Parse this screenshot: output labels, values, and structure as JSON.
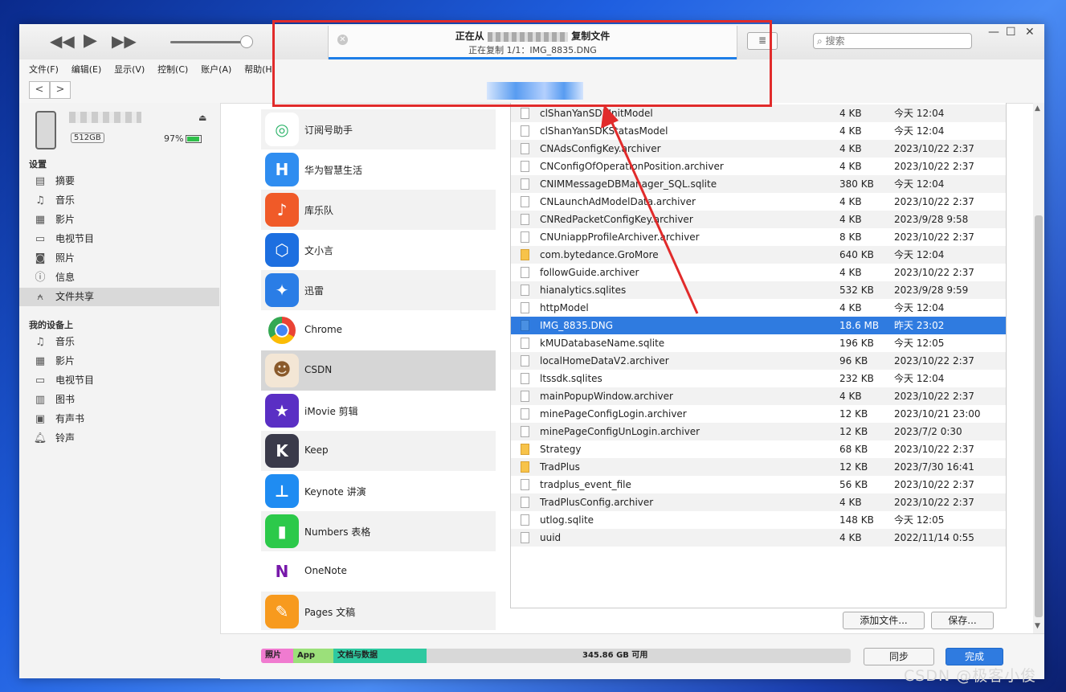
{
  "toolbar": {
    "rewind": "◀◀",
    "play": "▶",
    "forward": "▶▶",
    "status_title_prefix": "正在从",
    "status_title_suffix": "复制文件",
    "status_sub": "正在复制 1/1：IMG_8835.DNG",
    "list_icon": "≣",
    "search_placeholder": "搜索",
    "win_min": "—",
    "win_max": "☐",
    "win_close": "✕"
  },
  "menu": [
    "文件(F)",
    "编辑(E)",
    "显示(V)",
    "控制(C)",
    "账户(A)",
    "帮助(H)"
  ],
  "nav": {
    "back": "<",
    "forward": ">"
  },
  "device": {
    "capacity": "512GB",
    "battery": "97%",
    "eject": "⏏"
  },
  "sidebar": {
    "settings_title": "设置",
    "settings": [
      {
        "label": "摘要",
        "icon": "summary-icon"
      },
      {
        "label": "音乐",
        "icon": "music-icon"
      },
      {
        "label": "影片",
        "icon": "film-icon"
      },
      {
        "label": "电视节目",
        "icon": "tv-icon"
      },
      {
        "label": "照片",
        "icon": "camera-icon"
      },
      {
        "label": "信息",
        "icon": "info-icon"
      },
      {
        "label": "文件共享",
        "icon": "apps-icon"
      }
    ],
    "mydevice_title": "我的设备上",
    "mydevice": [
      {
        "label": "音乐",
        "icon": "music-icon"
      },
      {
        "label": "影片",
        "icon": "film-icon"
      },
      {
        "label": "电视节目",
        "icon": "tv-icon"
      },
      {
        "label": "图书",
        "icon": "book-icon"
      },
      {
        "label": "有声书",
        "icon": "audiobook-icon"
      },
      {
        "label": "铃声",
        "icon": "bell-icon"
      }
    ]
  },
  "apps": [
    {
      "label": "订阅号助手",
      "color": "#2fb46b",
      "glyph": "◎"
    },
    {
      "label": "华为智慧生活",
      "color": "#2f8df0",
      "glyph": "H"
    },
    {
      "label": "库乐队",
      "color": "#f05a28",
      "glyph": "♪"
    },
    {
      "label": "文小言",
      "color": "#1d6fe0",
      "glyph": "⬡"
    },
    {
      "label": "迅雷",
      "color": "#2a7de6",
      "glyph": "✦"
    },
    {
      "label": "Chrome",
      "color": "#ffffff",
      "glyph": "◉"
    },
    {
      "label": "CSDN",
      "color": "#f3e6d5",
      "glyph": "🐵"
    },
    {
      "label": "iMovie 剪辑",
      "color": "#5a2fc4",
      "glyph": "★"
    },
    {
      "label": "Keep",
      "color": "#3a3a4a",
      "glyph": "K"
    },
    {
      "label": "Keynote 讲演",
      "color": "#1f8cf2",
      "glyph": "⊥"
    },
    {
      "label": "Numbers 表格",
      "color": "#2cc94a",
      "glyph": "▮"
    },
    {
      "label": "OneNote",
      "color": "#ffffff",
      "glyph": "N"
    },
    {
      "label": "Pages 文稿",
      "color": "#f79a1e",
      "glyph": "✎"
    }
  ],
  "files": [
    {
      "name": "clShanYanSDKInitModel",
      "size": "4 KB",
      "date": "今天 12:04",
      "type": "file"
    },
    {
      "name": "clShanYanSDKStatasModel",
      "size": "4 KB",
      "date": "今天 12:04",
      "type": "file"
    },
    {
      "name": "CNAdsConfigKey.archiver",
      "size": "4 KB",
      "date": "2023/10/22 2:37",
      "type": "file"
    },
    {
      "name": "CNConfigOfOperationPosition.archiver",
      "size": "4 KB",
      "date": "2023/10/22 2:37",
      "type": "file"
    },
    {
      "name": "CNIMMessageDBManager_SQL.sqlite",
      "size": "380 KB",
      "date": "今天 12:04",
      "type": "file"
    },
    {
      "name": "CNLaunchAdModelData.archiver",
      "size": "4 KB",
      "date": "2023/10/22 2:37",
      "type": "file"
    },
    {
      "name": "CNRedPacketConfigKey.archiver",
      "size": "4 KB",
      "date": "2023/9/28 9:58",
      "type": "file"
    },
    {
      "name": "CNUniappProfileArchiver.archiver",
      "size": "8 KB",
      "date": "2023/10/22 2:37",
      "type": "file"
    },
    {
      "name": "com.bytedance.GroMore",
      "size": "640 KB",
      "date": "今天 12:04",
      "type": "folder"
    },
    {
      "name": "followGuide.archiver",
      "size": "4 KB",
      "date": "2023/10/22 2:37",
      "type": "file"
    },
    {
      "name": "hianalytics.sqlites",
      "size": "532 KB",
      "date": "2023/9/28 9:59",
      "type": "file"
    },
    {
      "name": "httpModel",
      "size": "4 KB",
      "date": "今天 12:04",
      "type": "file"
    },
    {
      "name": "IMG_8835.DNG",
      "size": "18.6 MB",
      "date": "昨天 23:02",
      "type": "image",
      "selected": true
    },
    {
      "name": "kMUDatabaseName.sqlite",
      "size": "196 KB",
      "date": "今天 12:05",
      "type": "file"
    },
    {
      "name": "localHomeDataV2.archiver",
      "size": "96 KB",
      "date": "2023/10/22 2:37",
      "type": "file"
    },
    {
      "name": "ltssdk.sqlites",
      "size": "232 KB",
      "date": "今天 12:04",
      "type": "file"
    },
    {
      "name": "mainPopupWindow.archiver",
      "size": "4 KB",
      "date": "2023/10/22 2:37",
      "type": "file"
    },
    {
      "name": "minePageConfigLogin.archiver",
      "size": "12 KB",
      "date": "2023/10/21 23:00",
      "type": "file"
    },
    {
      "name": "minePageConfigUnLogin.archiver",
      "size": "12 KB",
      "date": "2023/7/2 0:30",
      "type": "file"
    },
    {
      "name": "Strategy",
      "size": "68 KB",
      "date": "2023/10/22 2:37",
      "type": "folder"
    },
    {
      "name": "TradPlus",
      "size": "12 KB",
      "date": "2023/7/30 16:41",
      "type": "folder"
    },
    {
      "name": "tradplus_event_file",
      "size": "56 KB",
      "date": "2023/10/22 2:37",
      "type": "file"
    },
    {
      "name": "TradPlusConfig.archiver",
      "size": "4 KB",
      "date": "2023/10/22 2:37",
      "type": "file"
    },
    {
      "name": "utlog.sqlite",
      "size": "148 KB",
      "date": "今天 12:05",
      "type": "file"
    },
    {
      "name": "uuid",
      "size": "4 KB",
      "date": "2022/11/14 0:55",
      "type": "file"
    }
  ],
  "file_buttons": {
    "add": "添加文件...",
    "save": "保存..."
  },
  "storage": {
    "photos": "照片",
    "app": "App",
    "docs": "文档与数据",
    "free": "345.86 GB 可用",
    "colors": {
      "photos": "#f07bd0",
      "app": "#9be07a",
      "docs": "#2fc9a0"
    }
  },
  "bottom_buttons": {
    "sync": "同步",
    "done": "完成"
  },
  "watermark": "CSDN @极客小俊"
}
